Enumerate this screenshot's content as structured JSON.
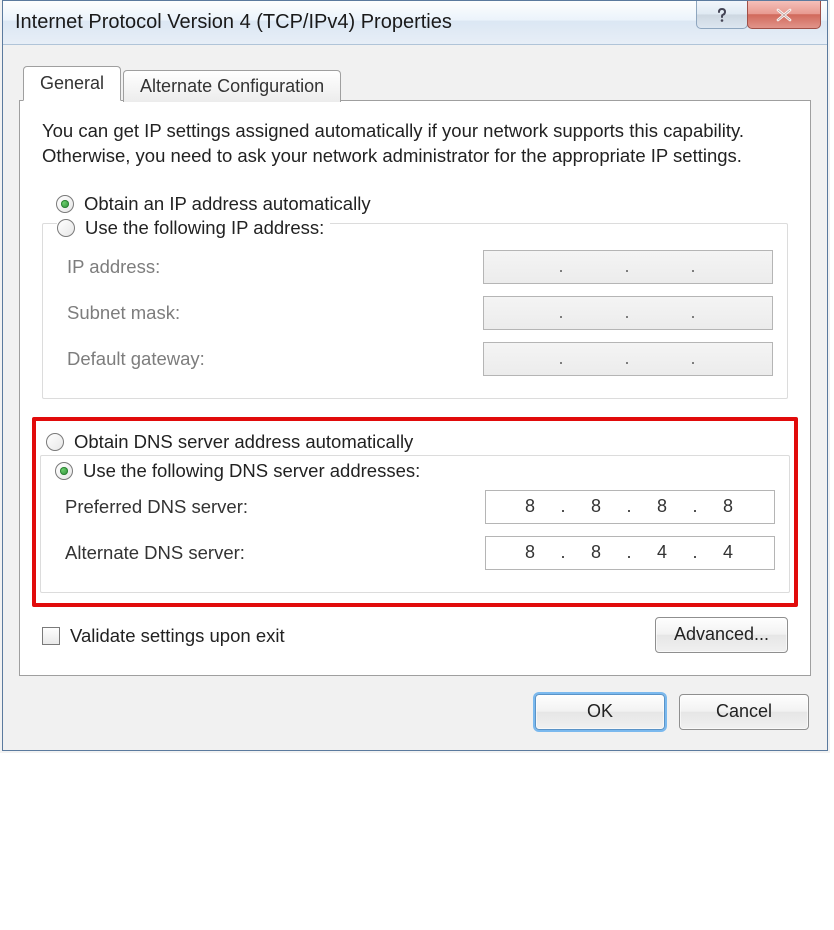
{
  "window": {
    "title": "Internet Protocol Version 4 (TCP/IPv4) Properties"
  },
  "tabs": {
    "general": "General",
    "alternate": "Alternate Configuration"
  },
  "helpertext": "You can get IP settings assigned automatically if your network supports this capability. Otherwise, you need to ask your network administrator for the appropriate IP settings.",
  "ip": {
    "radio_auto": "Obtain an IP address automatically",
    "radio_manual": "Use the following IP address:",
    "label_ip": "IP address:",
    "label_mask": "Subnet mask:",
    "label_gw": "Default gateway:"
  },
  "dns": {
    "radio_auto": "Obtain DNS server address automatically",
    "radio_manual": "Use the following DNS server addresses:",
    "label_pref": "Preferred DNS server:",
    "label_alt": "Alternate DNS server:",
    "preferred": [
      "8",
      "8",
      "8",
      "8"
    ],
    "alternate": [
      "8",
      "8",
      "4",
      "4"
    ]
  },
  "validate_label": "Validate settings upon exit",
  "buttons": {
    "advanced": "Advanced...",
    "ok": "OK",
    "cancel": "Cancel"
  }
}
